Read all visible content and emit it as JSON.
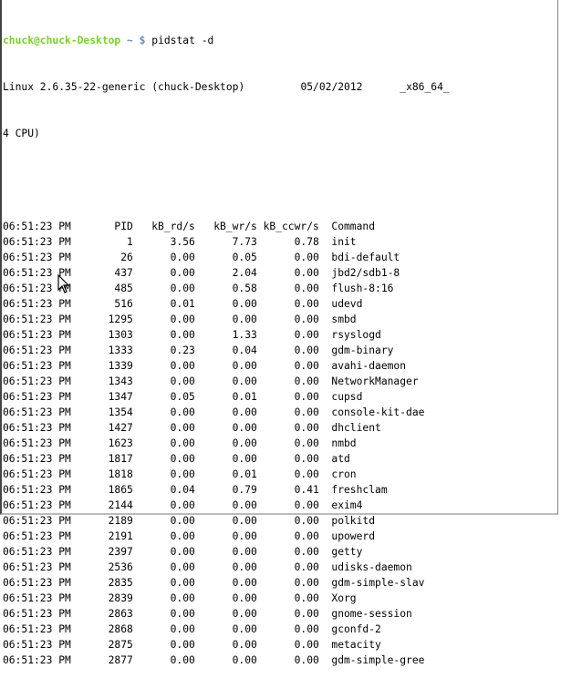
{
  "prompt": {
    "user_host": "chuck@chuck-Desktop",
    "path": "~",
    "symbol": "$",
    "command": "pidstat -d"
  },
  "sysinfo": {
    "kernel": "Linux 2.6.35-22-generic (chuck-Desktop)",
    "date": "05/02/2012",
    "arch": "_x86_64_",
    "cpus": "4 CPU)"
  },
  "table": {
    "headers": [
      "06:51:23 PM",
      "PID",
      "kB_rd/s",
      "kB_wr/s",
      "kB_ccwr/s",
      "Command"
    ],
    "rows": [
      [
        "06:51:23 PM",
        "1",
        "3.56",
        "7.73",
        "0.78",
        "init"
      ],
      [
        "06:51:23 PM",
        "26",
        "0.00",
        "0.05",
        "0.00",
        "bdi-default"
      ],
      [
        "06:51:23 PM",
        "437",
        "0.00",
        "2.04",
        "0.00",
        "jbd2/sdb1-8"
      ],
      [
        "06:51:23 PM",
        "485",
        "0.00",
        "0.58",
        "0.00",
        "flush-8:16"
      ],
      [
        "06:51:23 PM",
        "516",
        "0.01",
        "0.00",
        "0.00",
        "udevd"
      ],
      [
        "06:51:23 PM",
        "1295",
        "0.00",
        "0.00",
        "0.00",
        "smbd"
      ],
      [
        "06:51:23 PM",
        "1303",
        "0.00",
        "1.33",
        "0.00",
        "rsyslogd"
      ],
      [
        "06:51:23 PM",
        "1333",
        "0.23",
        "0.04",
        "0.00",
        "gdm-binary"
      ],
      [
        "06:51:23 PM",
        "1339",
        "0.00",
        "0.00",
        "0.00",
        "avahi-daemon"
      ],
      [
        "06:51:23 PM",
        "1343",
        "0.00",
        "0.00",
        "0.00",
        "NetworkManager"
      ],
      [
        "06:51:23 PM",
        "1347",
        "0.05",
        "0.01",
        "0.00",
        "cupsd"
      ],
      [
        "06:51:23 PM",
        "1354",
        "0.00",
        "0.00",
        "0.00",
        "console-kit-dae"
      ],
      [
        "06:51:23 PM",
        "1427",
        "0.00",
        "0.00",
        "0.00",
        "dhclient"
      ],
      [
        "06:51:23 PM",
        "1623",
        "0.00",
        "0.00",
        "0.00",
        "nmbd"
      ],
      [
        "06:51:23 PM",
        "1817",
        "0.00",
        "0.00",
        "0.00",
        "atd"
      ],
      [
        "06:51:23 PM",
        "1818",
        "0.00",
        "0.01",
        "0.00",
        "cron"
      ],
      [
        "06:51:23 PM",
        "1865",
        "0.04",
        "0.79",
        "0.41",
        "freshclam"
      ],
      [
        "06:51:23 PM",
        "2144",
        "0.00",
        "0.00",
        "0.00",
        "exim4"
      ],
      [
        "06:51:23 PM",
        "2189",
        "0.00",
        "0.00",
        "0.00",
        "polkitd"
      ],
      [
        "06:51:23 PM",
        "2191",
        "0.00",
        "0.00",
        "0.00",
        "upowerd"
      ],
      [
        "06:51:23 PM",
        "2397",
        "0.00",
        "0.00",
        "0.00",
        "getty"
      ],
      [
        "06:51:23 PM",
        "2536",
        "0.00",
        "0.00",
        "0.00",
        "udisks-daemon"
      ],
      [
        "06:51:23 PM",
        "2835",
        "0.00",
        "0.00",
        "0.00",
        "gdm-simple-slav"
      ],
      [
        "06:51:23 PM",
        "2839",
        "0.00",
        "0.00",
        "0.00",
        "Xorg"
      ],
      [
        "06:51:23 PM",
        "2863",
        "0.00",
        "0.00",
        "0.00",
        "gnome-session"
      ],
      [
        "06:51:23 PM",
        "2868",
        "0.00",
        "0.00",
        "0.00",
        "gconfd-2"
      ],
      [
        "06:51:23 PM",
        "2875",
        "0.00",
        "0.00",
        "0.00",
        "metacity"
      ],
      [
        "06:51:23 PM",
        "2877",
        "0.00",
        "0.00",
        "0.00",
        "gdm-simple-gree"
      ]
    ]
  }
}
